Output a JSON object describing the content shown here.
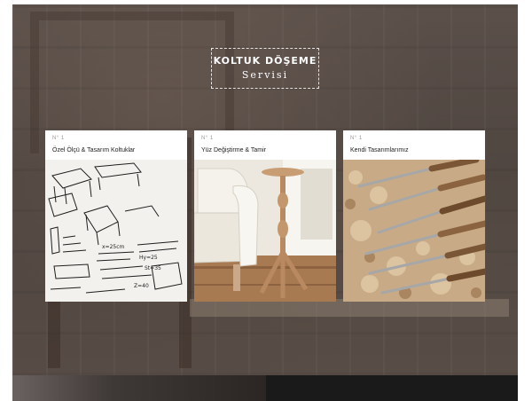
{
  "section": {
    "title_line1": "KOLTUK DÖŞEME",
    "title_line2": "Servisi"
  },
  "cards": [
    {
      "number": "N° 1",
      "title": "Özel Ölçü & Tasarım Koltuklar",
      "image": "sketch-drawings"
    },
    {
      "number": "N° 1",
      "title": "Yüz Değiştirme & Tamir",
      "image": "white-armchair"
    },
    {
      "number": "N° 1",
      "title": "Kendi Tasarımlarımız",
      "image": "carving-chisels"
    }
  ],
  "colors": {
    "overlay": "#4e443f",
    "card_bg": "#ffffff",
    "card_title": "#222222",
    "card_number": "#9a9a9a"
  }
}
